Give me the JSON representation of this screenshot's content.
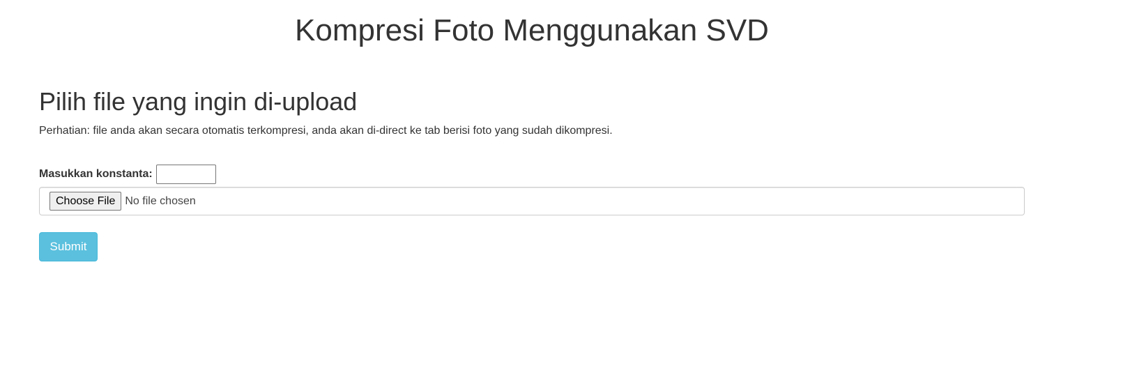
{
  "header": {
    "title": "Kompresi Foto Menggunakan SVD"
  },
  "upload_section": {
    "heading": "Pilih file yang ingin di-upload",
    "notice": "Perhatian: file anda akan secara otomatis terkompresi, anda akan di-direct ke tab berisi foto yang sudah dikompresi."
  },
  "form": {
    "konstanta_label": "Masukkan konstanta:",
    "konstanta_value": "",
    "file_button_label": "Choose File",
    "file_status": "No file chosen",
    "submit_label": "Submit"
  },
  "colors": {
    "submit_bg": "#5bc0de",
    "submit_border": "#46b8da",
    "text": "#333333"
  }
}
